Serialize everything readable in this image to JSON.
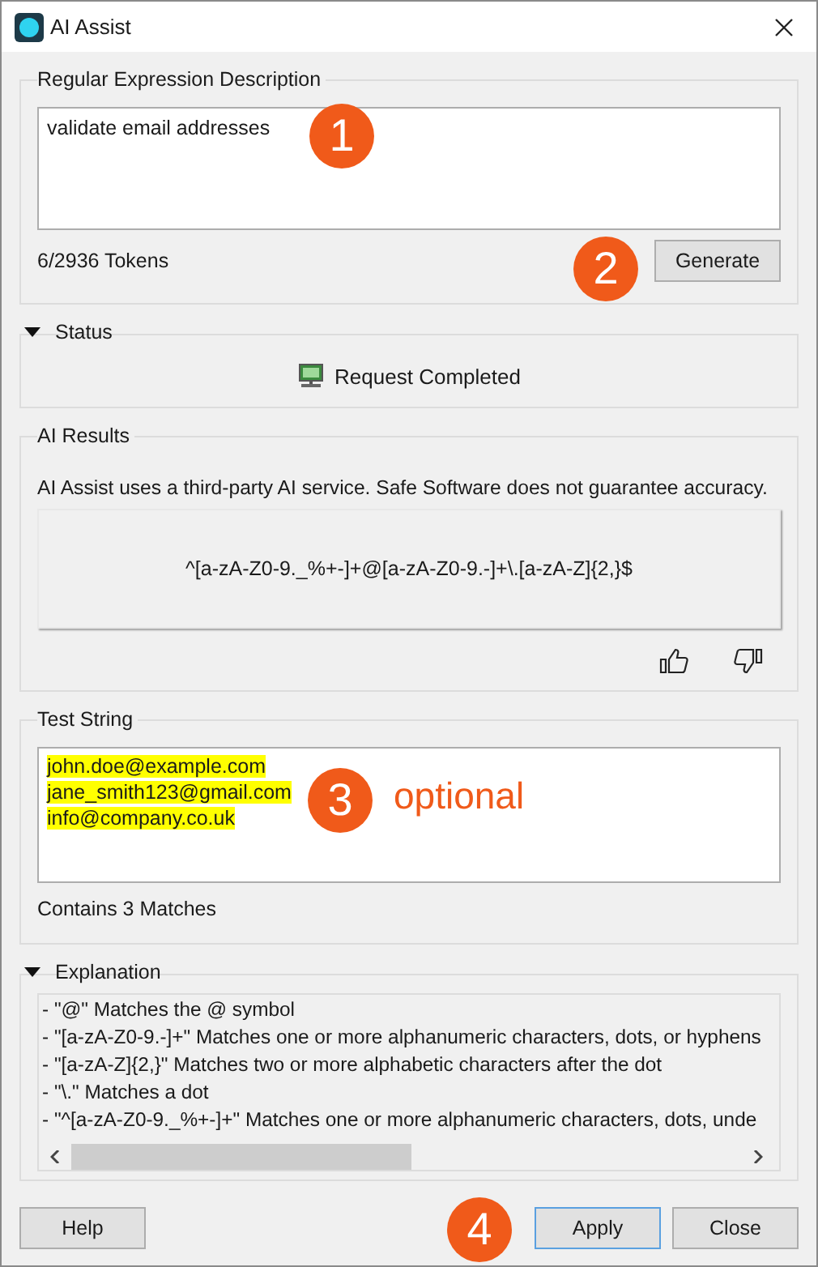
{
  "window": {
    "title": "AI Assist"
  },
  "description": {
    "label": "Regular Expression Description",
    "value": "validate email addresses",
    "tokens": "6/2936 Tokens",
    "button": "Generate",
    "callout": "1",
    "button_callout": "2"
  },
  "status": {
    "label": "Status",
    "expanded": true,
    "message": "Request Completed"
  },
  "results": {
    "label": "AI Results",
    "disclaimer": "AI Assist uses a third-party AI service. Safe Software does not guarantee accuracy.",
    "regex": "^[a-zA-Z0-9._%+-]+@[a-zA-Z0-9.-]+\\.[a-zA-Z]{2,}$"
  },
  "test": {
    "label": "Test String",
    "lines": [
      {
        "text": "john.doe@example.com",
        "highlighted": true
      },
      {
        "text": "jane_smith123@gmail.com",
        "highlighted": true
      },
      {
        "text": "info@company.co.uk",
        "highlighted": true
      }
    ],
    "matches": "Contains 3 Matches",
    "callout": "3",
    "note": "optional"
  },
  "explanation": {
    "label": "Explanation",
    "expanded": true,
    "lines": [
      "- \"@\" Matches the @ symbol",
      "- \"[a-zA-Z0-9.-]+\" Matches one or more alphanumeric characters, dots, or hyphens",
      "- \"[a-zA-Z]{2,}\" Matches two or more alphabetic characters after the dot",
      "- \"\\.\" Matches a dot",
      "- \"^[a-zA-Z0-9._%+-]+\" Matches one or more alphanumeric characters, dots, unde"
    ]
  },
  "buttons": [
    {
      "label": "Help",
      "default": false
    },
    {
      "label": "Apply",
      "default": true
    },
    {
      "label": "Close",
      "default": false
    }
  ],
  "footer_callout": "4"
}
